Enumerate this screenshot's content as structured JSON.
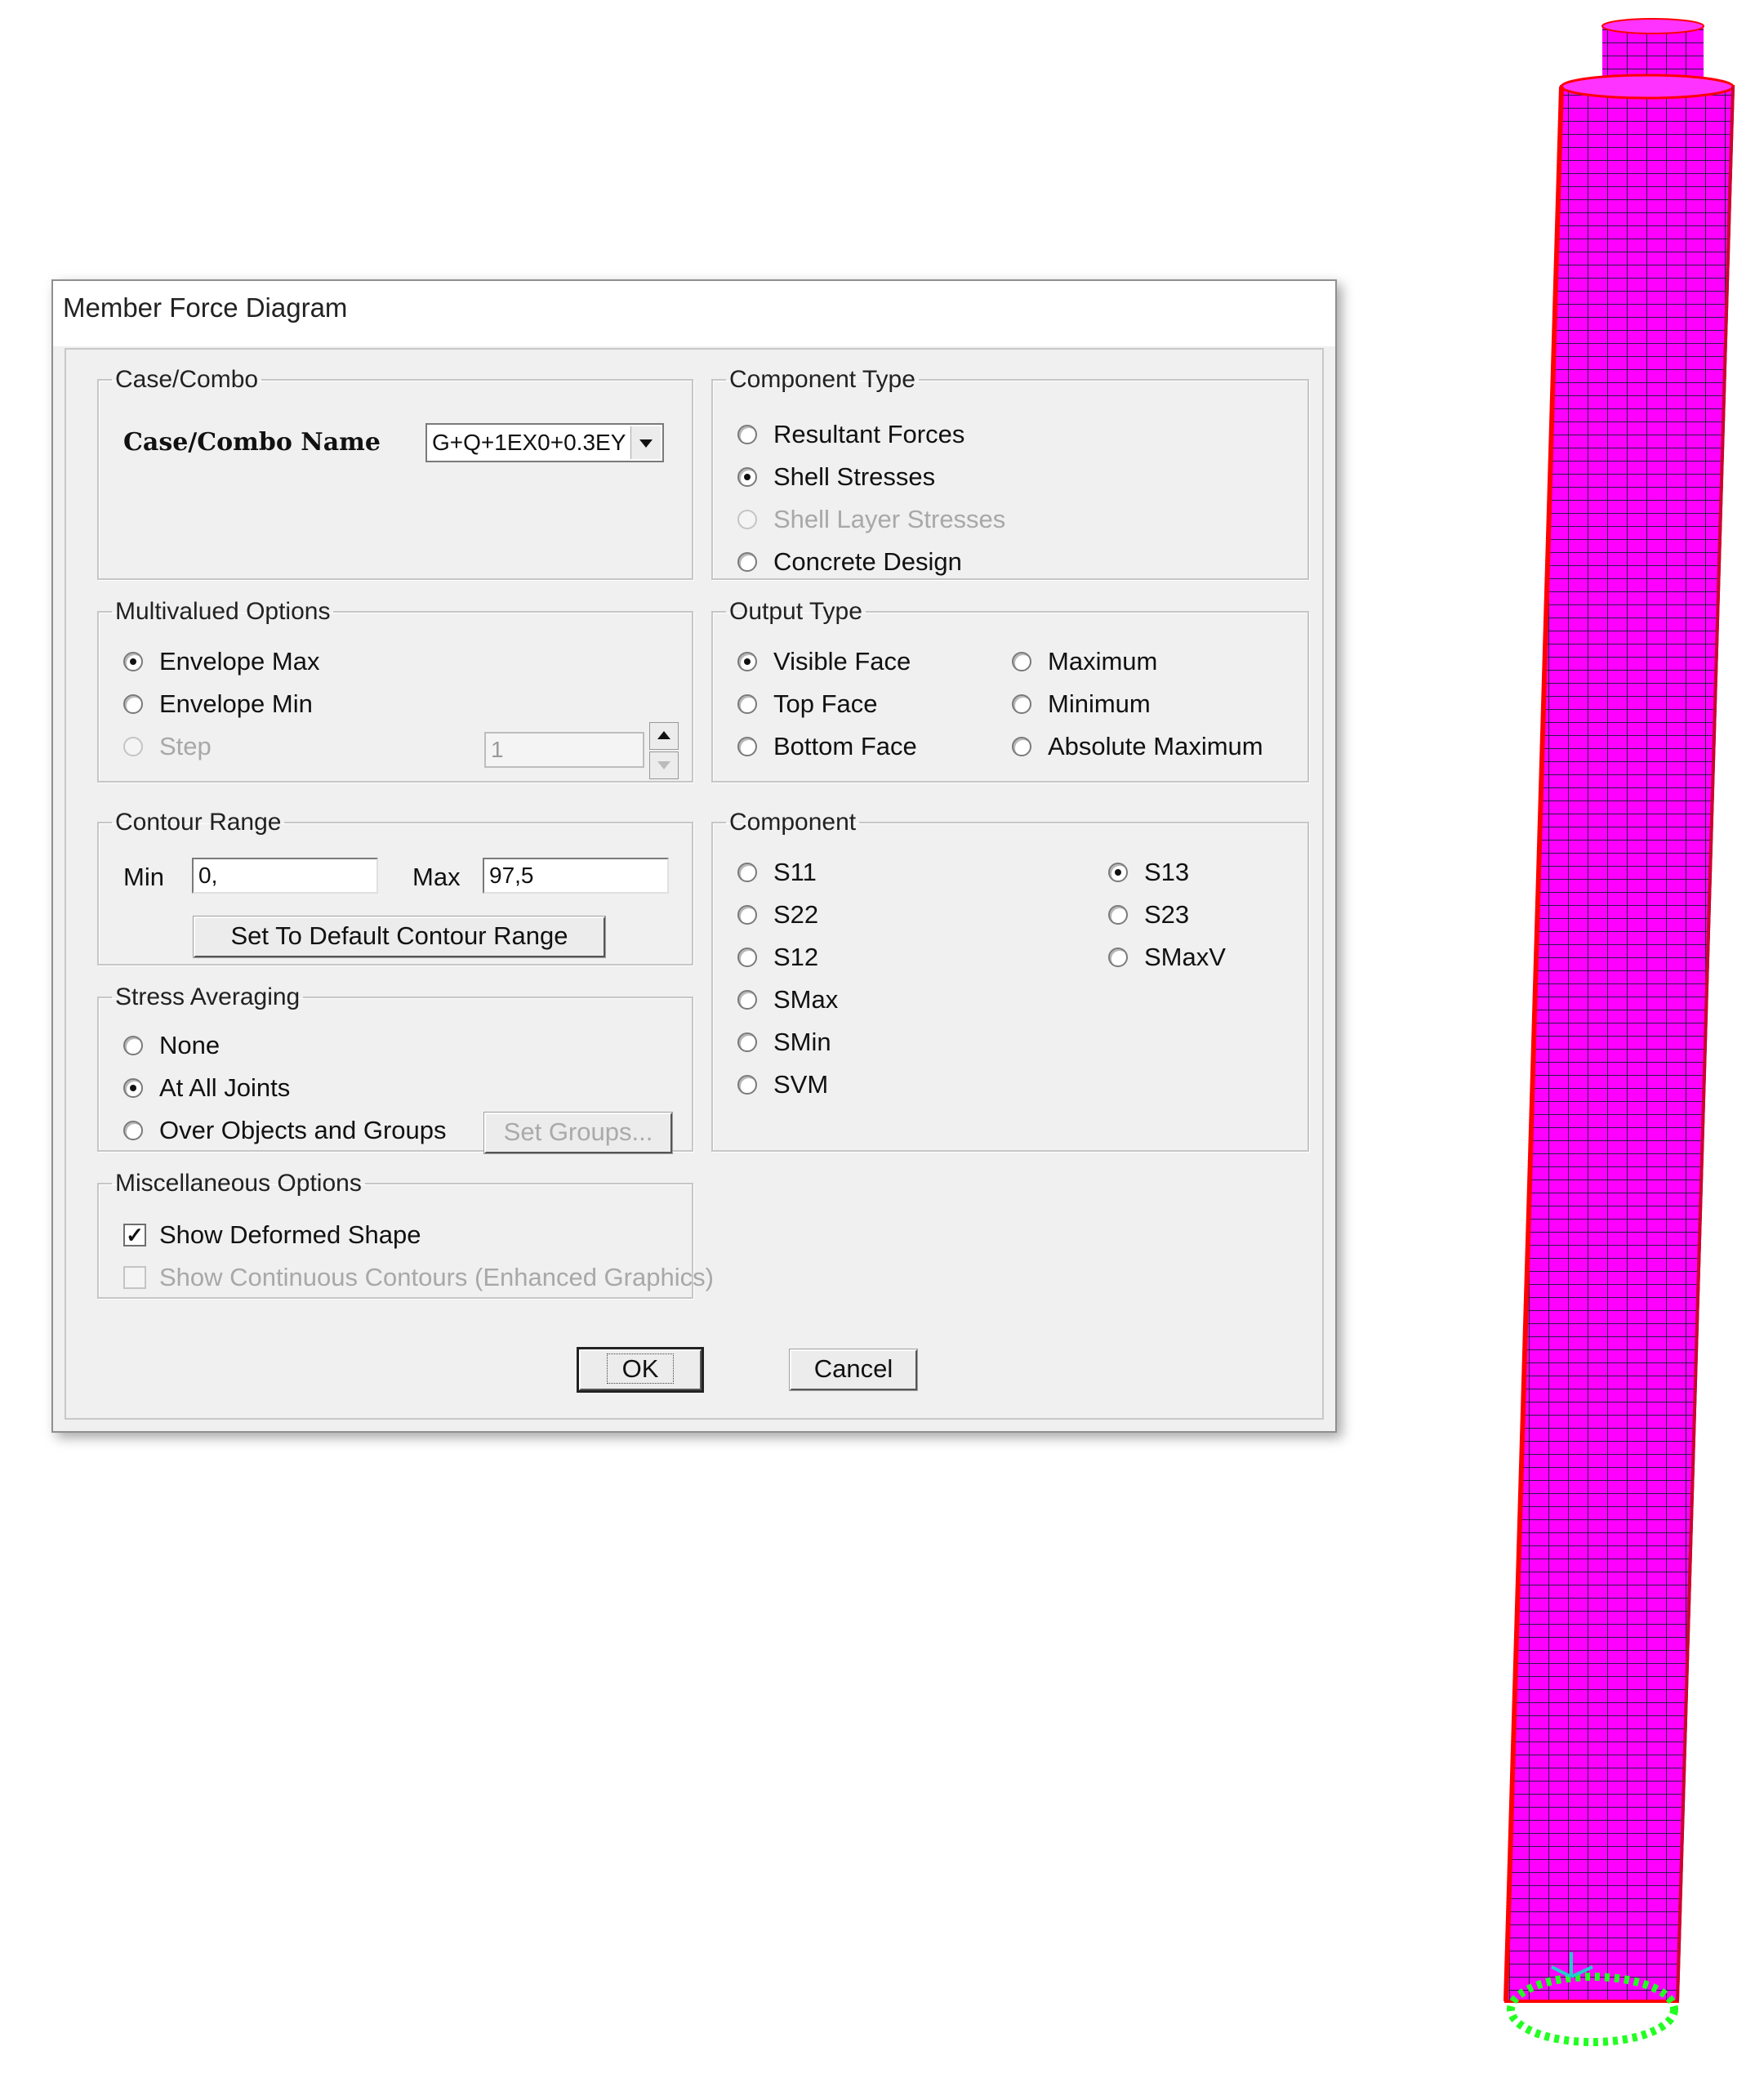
{
  "window": {
    "title": "Member Force Diagram"
  },
  "case_combo": {
    "legend": "Case/Combo",
    "name_label": "Case/Combo Name",
    "selected": "G+Q+1EX0+0.3EY"
  },
  "component_type": {
    "legend": "Component Type",
    "options": [
      "Resultant Forces",
      "Shell Stresses",
      "Shell Layer Stresses",
      "Concrete Design"
    ],
    "selected": "Shell Stresses"
  },
  "multivalued": {
    "legend": "Multivalued Options",
    "options": [
      "Envelope Max",
      "Envelope Min",
      "Step"
    ],
    "selected": "Envelope Max",
    "step_value": "1"
  },
  "output_type": {
    "legend": "Output Type",
    "options": [
      "Visible Face",
      "Top Face",
      "Bottom Face",
      "Maximum",
      "Minimum",
      "Absolute Maximum"
    ],
    "selected": "Visible Face"
  },
  "contour_range": {
    "legend": "Contour Range",
    "min_label": "Min",
    "min_value": "0,",
    "max_label": "Max",
    "max_value": "97,5",
    "default_button": "Set To Default Contour Range"
  },
  "component": {
    "legend": "Component",
    "options": [
      "S11",
      "S22",
      "S12",
      "SMax",
      "SMin",
      "SVM",
      "S13",
      "S23",
      "SMaxV"
    ],
    "selected": "S13"
  },
  "stress_averaging": {
    "legend": "Stress Averaging",
    "options": [
      "None",
      "At All Joints",
      "Over Objects and Groups"
    ],
    "selected": "At All Joints",
    "set_groups_button": "Set Groups..."
  },
  "misc": {
    "legend": "Miscellaneous Options",
    "show_deformed": "Show Deformed Shape",
    "show_deformed_checked": true,
    "show_continuous": "Show Continuous Contours  (Enhanced Graphics)",
    "show_continuous_checked": false
  },
  "buttons": {
    "ok": "OK",
    "cancel": "Cancel"
  },
  "model_view": {
    "shell_color": "#ff00ff",
    "edge_color": "#ff0000",
    "mesh_color": "#2a1a4a",
    "support_color": "#22ff22",
    "axis_color": "#22cccc"
  }
}
